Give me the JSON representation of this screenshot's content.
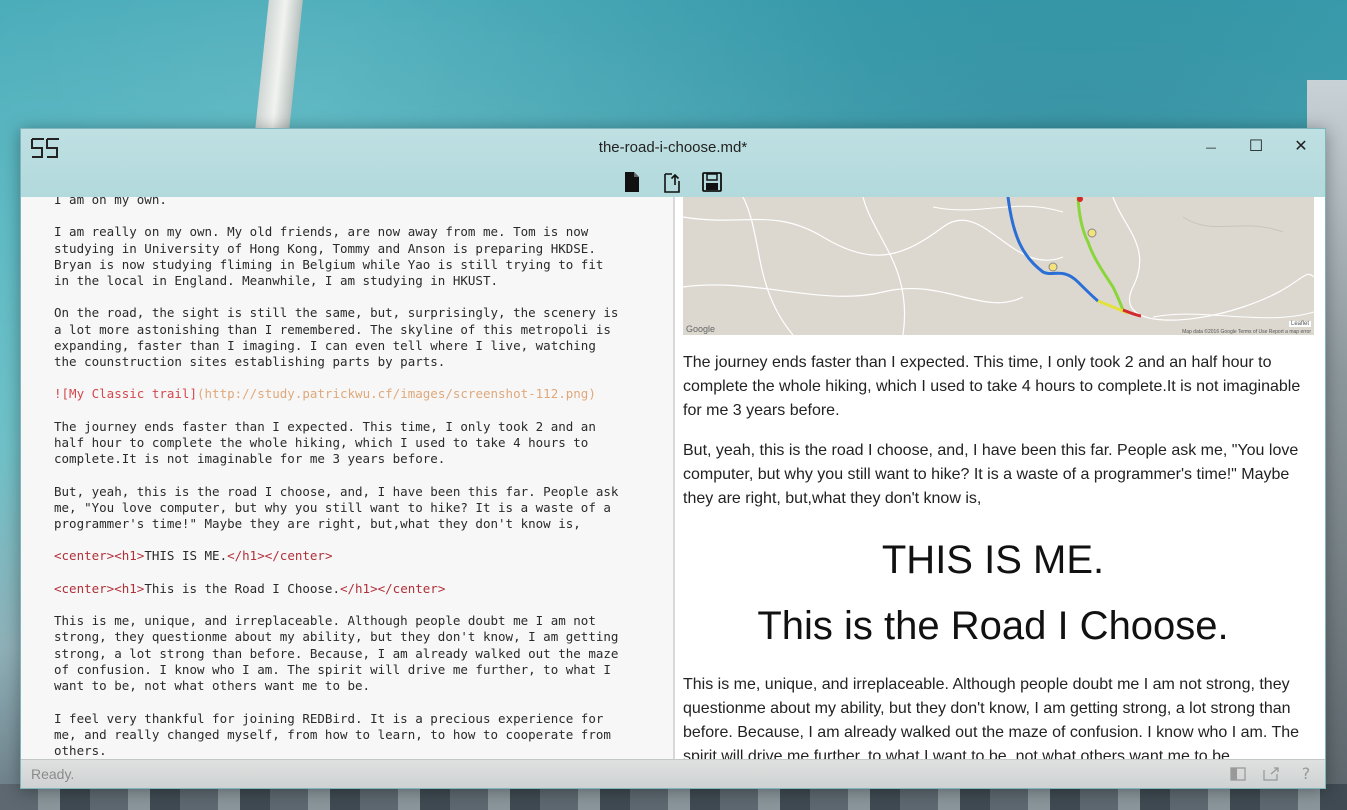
{
  "window": {
    "title": "the-road-i-choose.md*"
  },
  "window_controls": {
    "minimize": "—",
    "maximize": "☐",
    "close": "✕"
  },
  "toolbar": {
    "icons": [
      "new-file-icon",
      "export-icon",
      "save-icon"
    ]
  },
  "editor": {
    "lines": [
      "I am on my own.",
      "",
      "I am really on my own. My old friends, are now away from me. Tom is now",
      "studying in University of Hong Kong, Tommy and Anson is preparing HKDSE.",
      "Bryan is now studying fliming in Belgium while Yao is still trying to fit",
      "in the local in England. Meanwhile, I am studying in HKUST.",
      "",
      "On the road, the sight is still the same, but, surprisingly, the scenery is",
      "a lot more astonishing than I remembered. The skyline of this metropoli is",
      "expanding, faster than I imaging. I can even tell where I live, watching",
      "the counstruction sites establishing parts by parts.",
      "",
      "",
      "",
      "The journey ends faster than I expected. This time, I only took 2 and an",
      "half hour to complete the whole hiking, which I used to take 4 hours to",
      "complete.It is not imaginable for me 3 years before.",
      "",
      "But, yeah, this is the road I choose, and, I have been this far. People ask",
      "me, \"You love computer, but why you still want to hike? It is a waste of a",
      "programmer's time!\" Maybe they are right, but,what they don't know is,",
      "",
      "",
      "",
      "",
      "",
      "This is me, unique, and irreplaceable. Although people doubt me I am not",
      "strong, they questionme about my ability, but they don't know, I am getting",
      "strong, a lot strong than before. Because, I am already walked out the maze",
      "of confusion. I know who I am. The spirit will drive me further, to what I",
      "want to be, not what others want me to be.",
      "",
      "I feel very thankful for joining REDBird. It is a precious experience for",
      "me, and really changed myself, from how to learn, to how to cooperate from",
      "others."
    ],
    "image_markdown": {
      "alt": "![My Classic trail]",
      "url": "(http://study.patrickwu.cf/images/screenshot-112.png)"
    },
    "heading_line_1": {
      "open_tag": "<center><h1>",
      "text": "THIS IS ME.",
      "close_tag": "</h1></center>"
    },
    "heading_line_2": {
      "open_tag": "<center><h1>",
      "text": "This is the Road I Choose.",
      "close_tag": "</h1></center>"
    }
  },
  "preview": {
    "paragraph_1": "The journey ends faster than I expected. This time, I only took 2 and an half hour to complete the whole hiking, which I used to take 4 hours to complete.It is not imaginable for me 3 years before.",
    "paragraph_2": "But, yeah, this is the road I choose, and, I have been this far. People ask me, \"You love computer, but why you still want to hike? It is a waste of a programmer's time!\" Maybe they are right, but,what they don't know is,",
    "heading_1": "THIS IS ME.",
    "heading_2": "This is the Road I Choose.",
    "paragraph_3": "This is me, unique, and irreplaceable. Although people doubt me I am not strong, they questionme about my ability, but they don't know, I am getting strong, a lot strong than before. Because, I am already walked out the maze of confusion. I know who I am. The spirit will drive me further, to what I want to be, not what others want me to be.",
    "map": {
      "google_label": "Google",
      "leaflet_label": "Leaflet",
      "attribution": "Map data ©2016 Google   Terms of Use   Report a map error"
    }
  },
  "statusbar": {
    "text": "Ready.",
    "help": "?"
  },
  "colors": {
    "titlebar": "#b7dcdf",
    "route_blue": "#2a6fd6",
    "route_yellow": "#e3e13a",
    "route_green": "#8ad63a",
    "route_red": "#d4282c"
  }
}
